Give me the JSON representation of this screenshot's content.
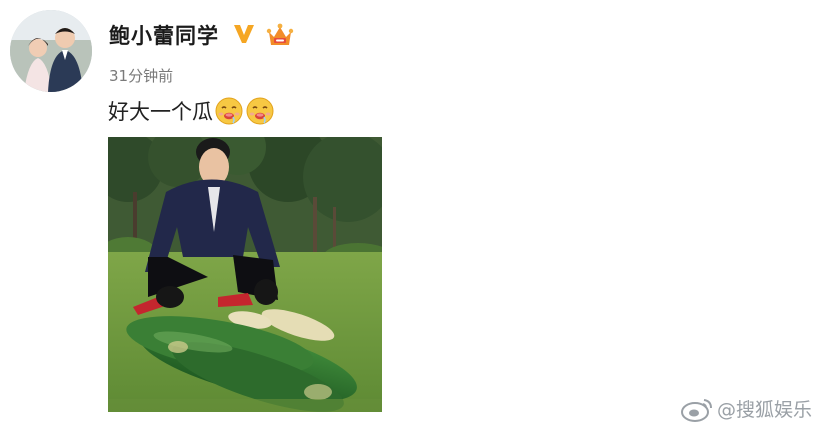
{
  "post": {
    "username": "鲍小蕾同学",
    "timestamp": "31分钟前",
    "text": "好大一个瓜",
    "emoji_count": 2,
    "emoji_name": "drooling-face-emoji"
  },
  "badges": {
    "verified_icon": "verified-v-icon",
    "vip_icon": "vip-crown-icon",
    "verified_color": "#f5a623",
    "vip_color": "#f28c28"
  },
  "watermark": {
    "text": "@搜狐娱乐",
    "icon": "weibo-logo-icon"
  },
  "colors": {
    "name_text": "#1b1b1b",
    "time_text": "#7a7a7a",
    "body_text": "#222222",
    "watermark": "#9aa0a6"
  }
}
